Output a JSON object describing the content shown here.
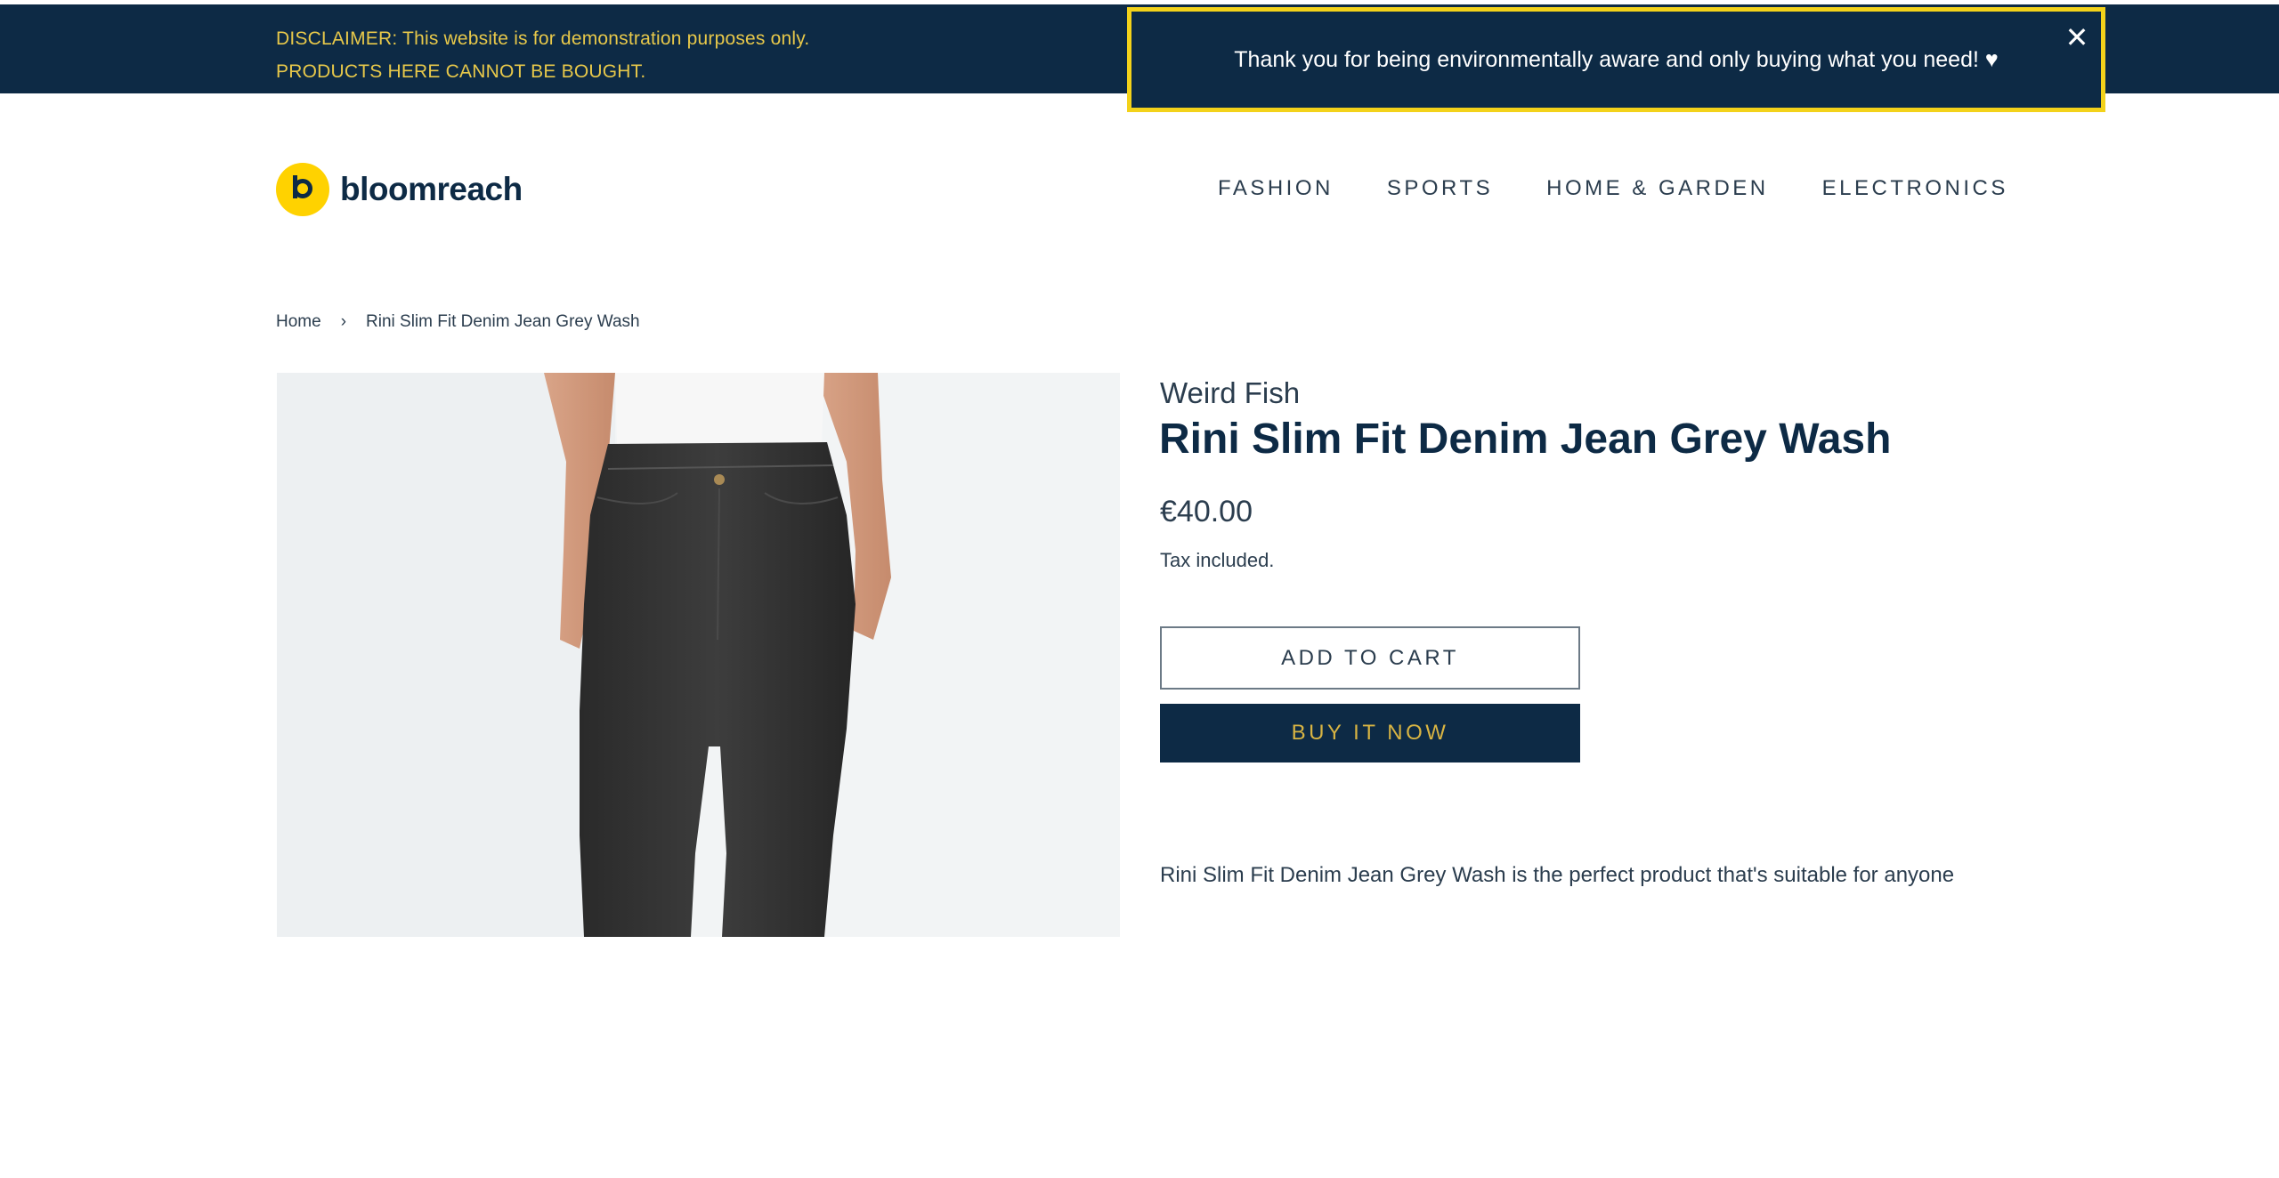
{
  "banner": {
    "disclaimer": "DISCLAIMER: This website is for demonstration purposes only. PRODUCTS HERE CANNOT BE BOUGHT.",
    "notice": "Thank you for being environmentally aware and only buying what you need! ♥",
    "close_icon": "close-icon",
    "close_glyph": "✕"
  },
  "header": {
    "logo_text": "bloomreach",
    "logo_icon": "bloomreach-logo-icon",
    "nav": [
      "FASHION",
      "SPORTS",
      "HOME & GARDEN",
      "ELECTRONICS"
    ]
  },
  "breadcrumb": {
    "home": "Home",
    "separator": "›",
    "current": "Rini Slim Fit Denim Jean Grey Wash"
  },
  "product": {
    "vendor": "Weird Fish",
    "title": "Rini Slim Fit Denim Jean Grey Wash",
    "price": "€40.00",
    "tax_note": "Tax included.",
    "add_to_cart": "ADD TO CART",
    "buy_now": "BUY IT NOW",
    "description": "Rini Slim Fit Denim Jean Grey Wash is the perfect product that's suitable for anyone"
  },
  "colors": {
    "navy": "#0d2a45",
    "gold_text": "#e7c84a",
    "highlight_border": "#f3d21a",
    "logo_yellow": "#ffd200"
  }
}
